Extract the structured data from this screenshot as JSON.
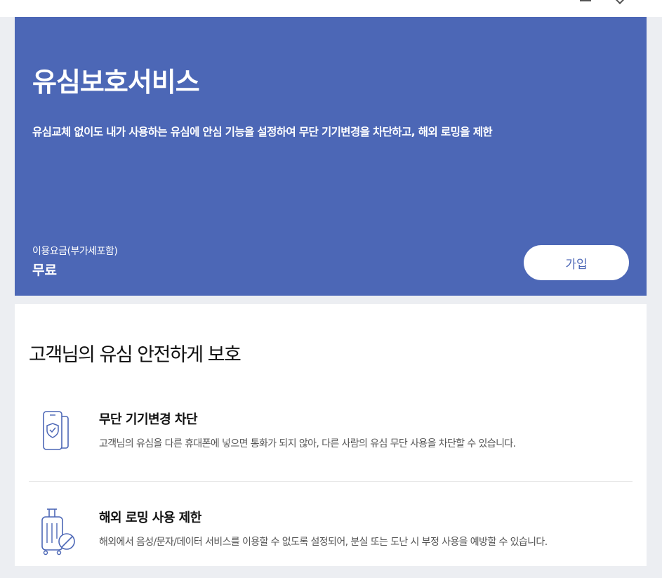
{
  "hero": {
    "title": "유심보호서비스",
    "description": "유심교체 없이도 내가 사용하는 유심에 안심 기능을 설정하여 무단 기기변경을 차단하고, 해외 로밍을 제한",
    "fee_label": "이용요금(부가세포함)",
    "fee_value": "무료",
    "join_label": "가입",
    "background_color": "#4c67b6"
  },
  "section": {
    "title": "고객님의 유심 안전하게 보호",
    "features": [
      {
        "icon": "phone-shield-icon",
        "title": "무단 기기변경 차단",
        "description": "고객님의 유심을 다른 휴대폰에 넣으면 통화가 되지 않아, 다른 사람의 유심 무단 사용을 차단할 수 있습니다."
      },
      {
        "icon": "luggage-blocked-icon",
        "title": "해외 로밍 사용 제한",
        "description": "해외에서 음성/문자/데이터 서비스를 이용할 수 없도록 설정되어, 분실 또는 도난 시 부정 사용을 예방할 수 있습니다."
      }
    ]
  }
}
